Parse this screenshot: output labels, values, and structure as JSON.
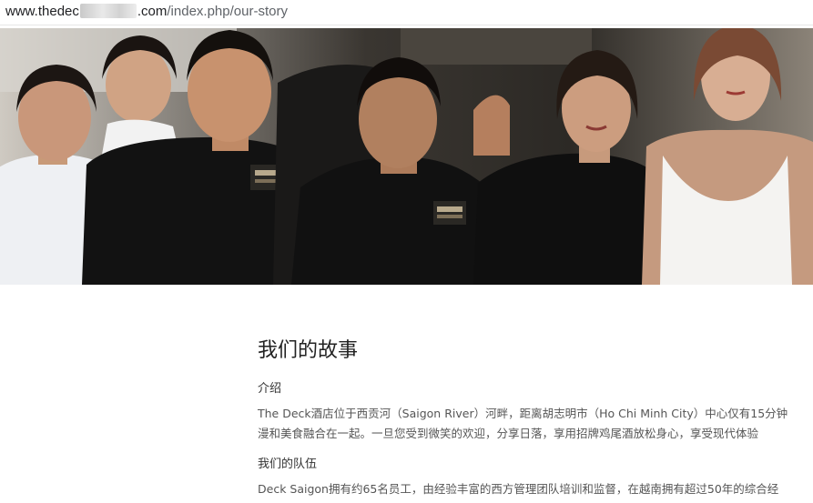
{
  "browser": {
    "url_host_prefix": "www.thedec",
    "url_host_suffix": ".com",
    "url_path": "/index.php/our-story"
  },
  "hero": {
    "badge_text": "THE DECK"
  },
  "story": {
    "title": "我们的故事",
    "intro_heading": "介绍",
    "intro_line1": "The Deck酒店位于西贡河（Saigon River）河畔，距离胡志明市（Ho Chi Minh City）中心仅有15分钟",
    "intro_line2": "漫和美食融合在一起。一旦您受到微笑的欢迎，分享日落，享用招牌鸡尾酒放松身心，享受现代体验",
    "team_heading": "我们的队伍",
    "team_line1": "Deck Saigon拥有约65名员工，由经验丰富的西方管理团队培训和监督，在越南拥有超过50年的综合经"
  }
}
